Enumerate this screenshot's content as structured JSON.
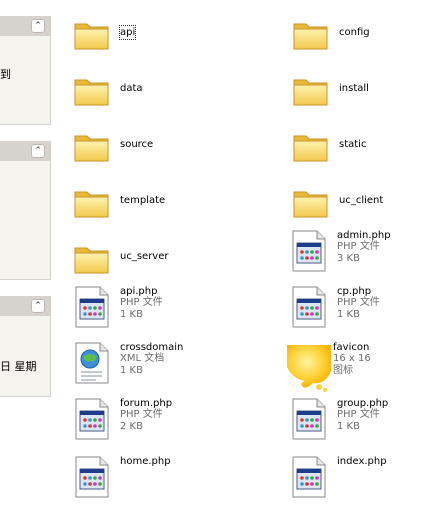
{
  "taskpane": {
    "panel1": {
      "fragment": "到"
    },
    "panel2": {
      "fragment": ""
    },
    "panel3": {
      "fragment": "日 星期"
    },
    "collapse_glyph": "⌃"
  },
  "files": [
    {
      "name": "api",
      "kind": "folder",
      "type": "",
      "size": "",
      "selected": true
    },
    {
      "name": "config",
      "kind": "folder",
      "type": "",
      "size": ""
    },
    {
      "name": "data",
      "kind": "folder",
      "type": "",
      "size": ""
    },
    {
      "name": "install",
      "kind": "folder",
      "type": "",
      "size": ""
    },
    {
      "name": "source",
      "kind": "folder",
      "type": "",
      "size": ""
    },
    {
      "name": "static",
      "kind": "folder",
      "type": "",
      "size": ""
    },
    {
      "name": "template",
      "kind": "folder",
      "type": "",
      "size": ""
    },
    {
      "name": "uc_client",
      "kind": "folder",
      "type": "",
      "size": ""
    },
    {
      "name": "uc_server",
      "kind": "folder",
      "type": "",
      "size": ""
    },
    {
      "name": "admin.php",
      "kind": "php",
      "type": "PHP 文件",
      "size": "3 KB"
    },
    {
      "name": "api.php",
      "kind": "php",
      "type": "PHP 文件",
      "size": "1 KB"
    },
    {
      "name": "cp.php",
      "kind": "php",
      "type": "PHP 文件",
      "size": "1 KB"
    },
    {
      "name": "crossdomain",
      "kind": "xml",
      "type": "XML 文档",
      "size": "1 KB"
    },
    {
      "name": "favicon",
      "kind": "ico",
      "type": "16 x 16",
      "size": "图标"
    },
    {
      "name": "forum.php",
      "kind": "php",
      "type": "PHP 文件",
      "size": "2 KB"
    },
    {
      "name": "group.php",
      "kind": "php",
      "type": "PHP 文件",
      "size": "1 KB"
    },
    {
      "name": "home.php",
      "kind": "php",
      "type": "",
      "size": ""
    },
    {
      "name": "index.php",
      "kind": "php",
      "type": "",
      "size": ""
    }
  ]
}
